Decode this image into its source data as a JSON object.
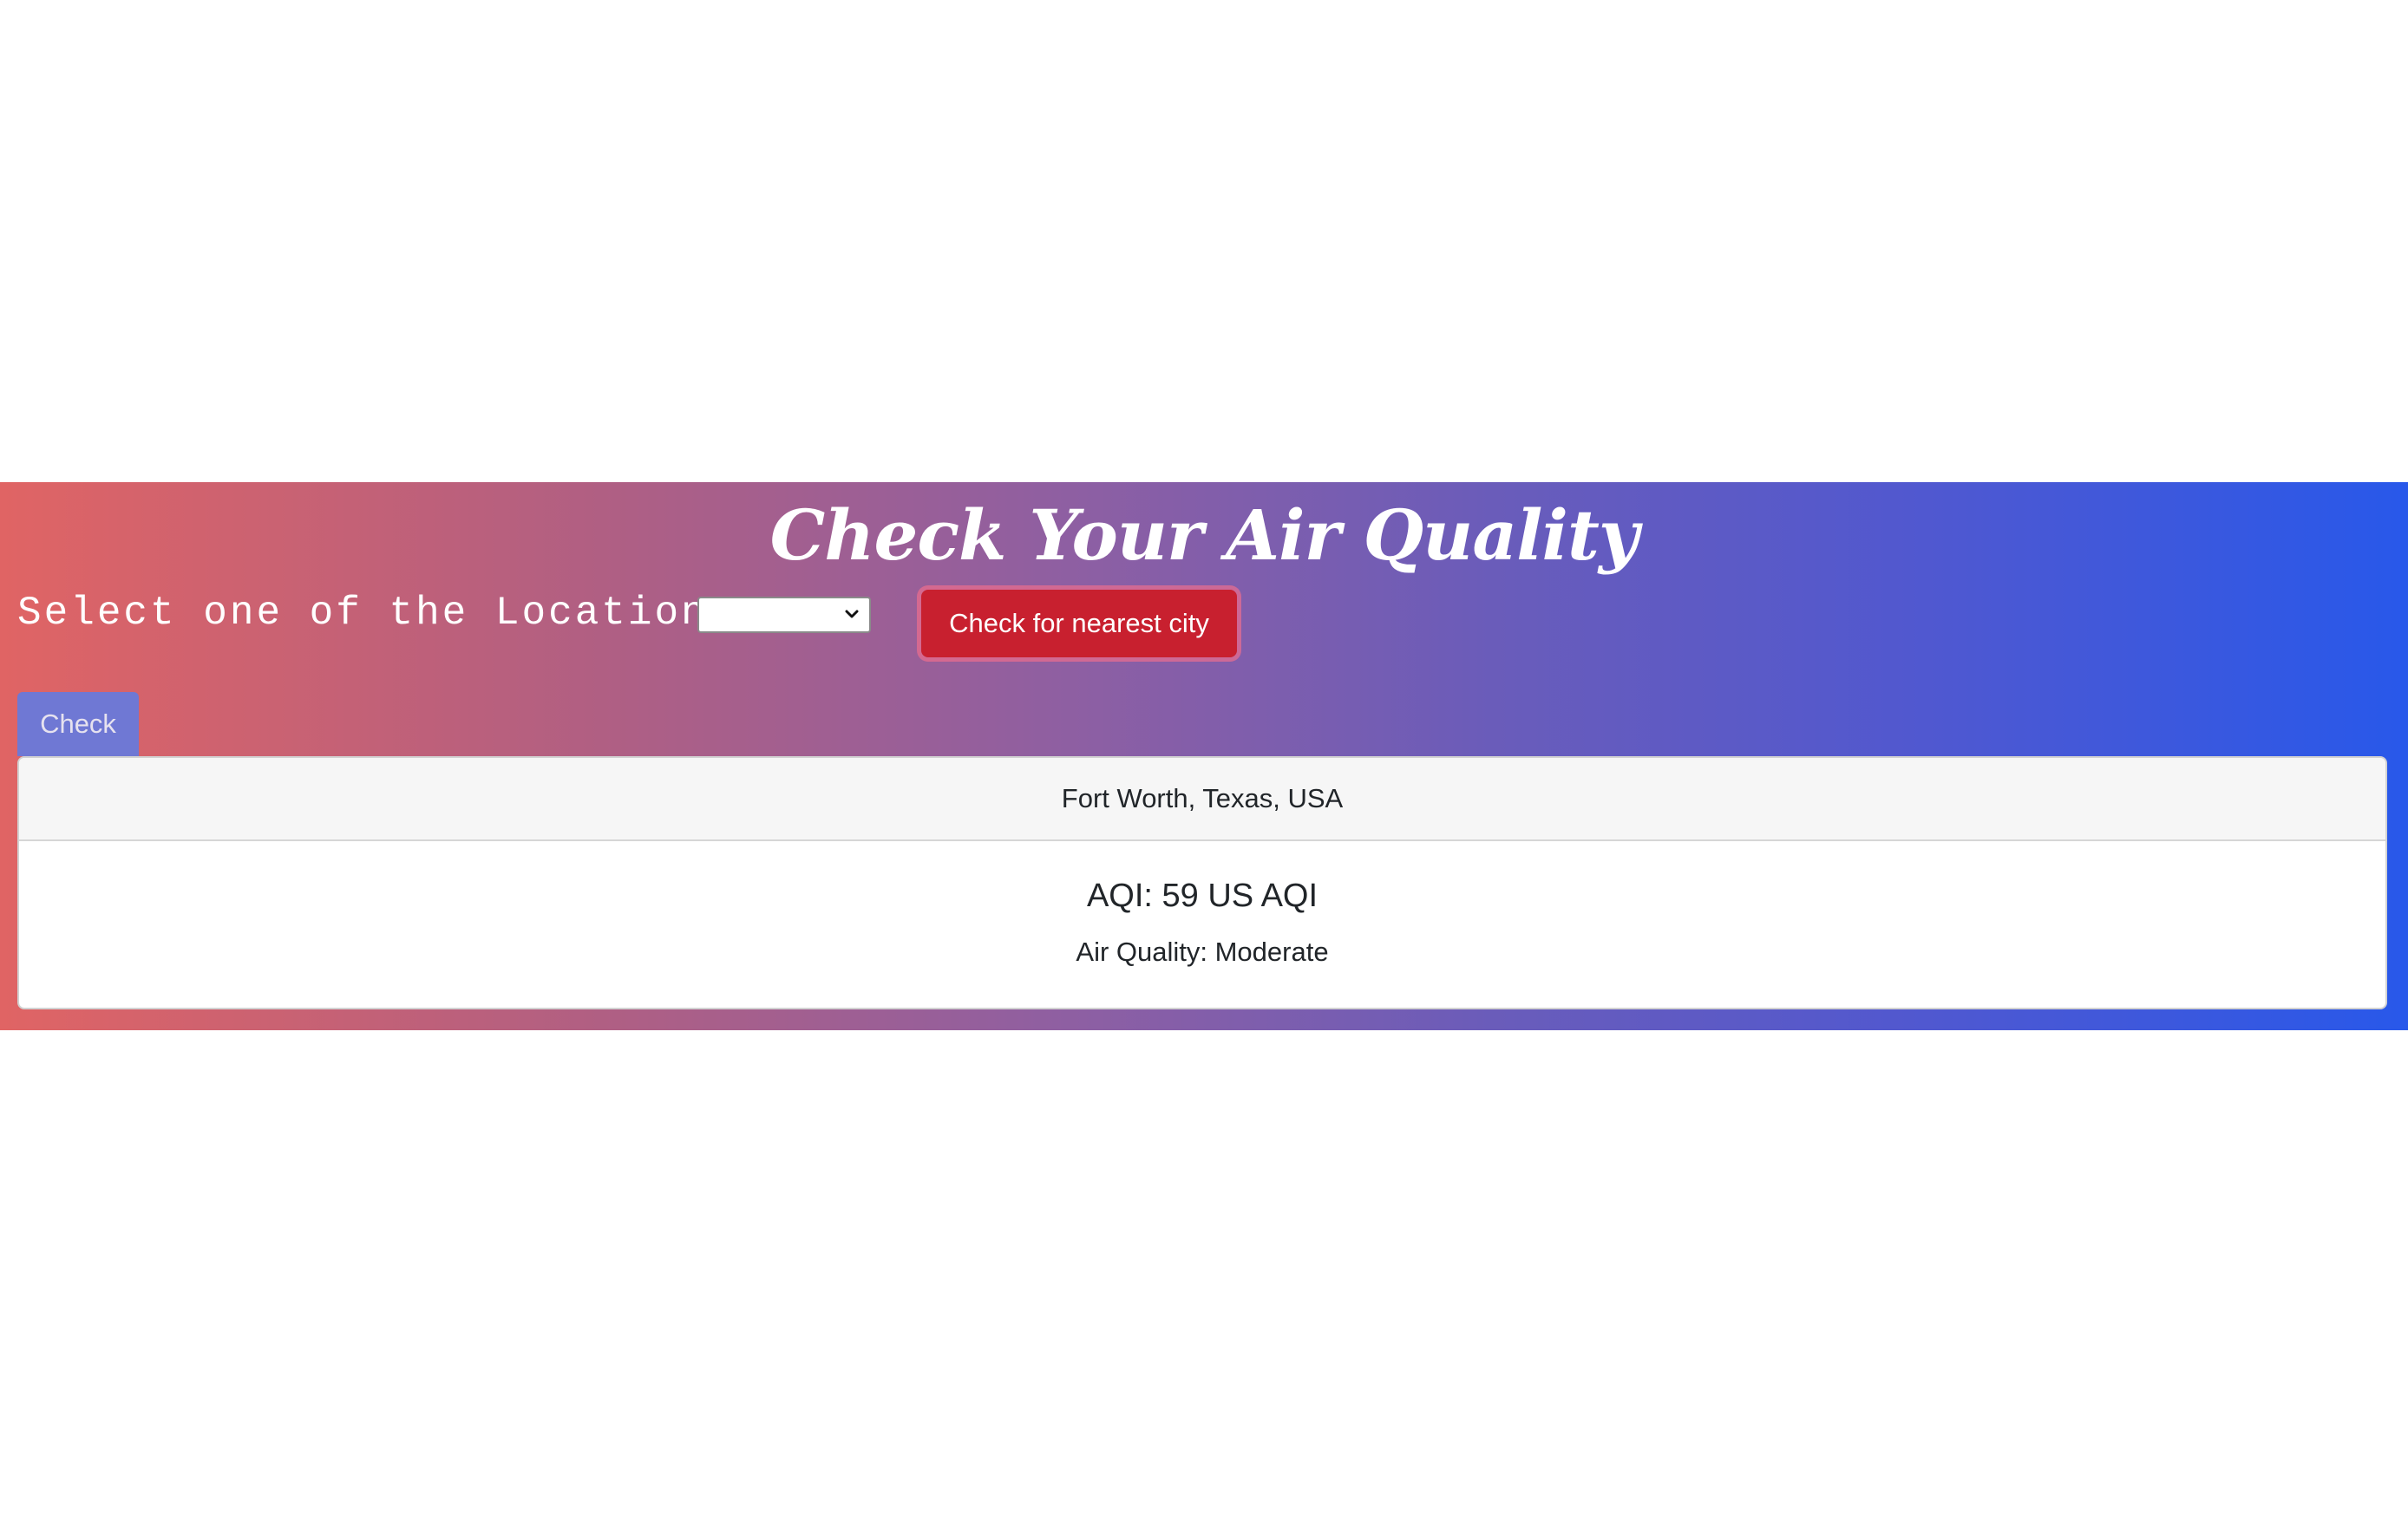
{
  "header": {
    "title": "Check Your Air Quality"
  },
  "controls": {
    "select_label": "Select one of the Location",
    "location_select": {
      "selected_value": ""
    },
    "nearest_button_label": "Check for nearest city",
    "check_button_label": "Check"
  },
  "result": {
    "location": "Fort Worth, Texas, USA",
    "aqi": "AQI: 59 US AQI",
    "quality": "Air Quality: Moderate"
  },
  "colors": {
    "gradient_start": "#e06464",
    "gradient_end": "#2858ea",
    "nearest_button": "#c8202f",
    "check_button": "#6f78d4"
  },
  "icons": {
    "select_chevron": "chevron-down-icon"
  }
}
